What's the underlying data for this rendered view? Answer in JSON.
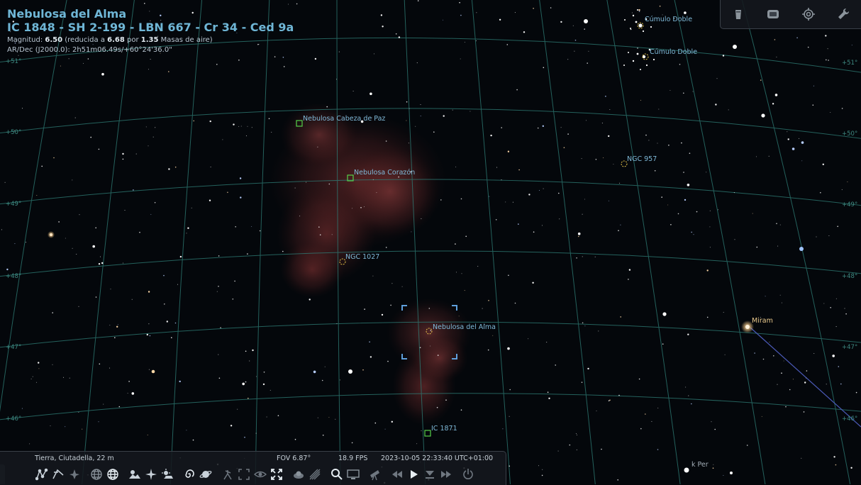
{
  "object": {
    "name": "Nebulosa del Alma",
    "designations": "IC 1848 - SH 2-199 - LBN 667 - Cr 34 - Ced 9a",
    "magnitude_label": "Magnitud:",
    "magnitude": "6.50",
    "magnitude_extra_1": "(reducida a",
    "magnitude_reduced": "6.68",
    "magnitude_extra_2": "por",
    "airmass": "1.35",
    "magnitude_extra_3": "Masas de aire)",
    "radec": "AR/Dec (J2000.0): 2h51m06.49s/+60°24'36.0\""
  },
  "labels": {
    "cabeza_paz": "Nebulosa Cabeza de Paz",
    "corazon": "Nebulosa Corazón",
    "ngc1027": "NGC 1027",
    "alma": "Nebulosa del Alma",
    "ic1871": "IC 1871",
    "ngc957": "NGC 957",
    "cumulo1": "Cúmulo Doble",
    "cumulo2": "Cúmulo Doble",
    "miram": "Miram",
    "kper": "k Per"
  },
  "grid_labels": {
    "l51": "+51°",
    "r51": "+51°",
    "l50": "+50°",
    "r50": "+50°",
    "l49": "+49°",
    "r49": "+49°",
    "l48": "+48°",
    "r48": "+48°",
    "l47": "+47°",
    "r47": "+47°",
    "l46": "+46°",
    "r46": "+46°"
  },
  "status": {
    "location": "Tierra, Ciutadella, 22 m",
    "fov": "FOV 6.87°",
    "fps": "18.9 FPS",
    "datetime": "2023-10-05 22:33:40 UTC+01:00"
  },
  "toolbar_top_right": [
    "window-icon",
    "tv-icon",
    "target-icon",
    "wrench-icon"
  ],
  "toolbar_bottom": [
    "constellation-lines-icon",
    "constellation-labels-icon",
    "constellation-art-icon",
    "equatorial-grid-icon",
    "azimuthal-grid-icon",
    "ground-icon",
    "cardinal-points-icon",
    "atmosphere-icon",
    "nebulae-icon",
    "planet-labels-icon",
    "equatorial-mount-icon",
    "center-object-icon",
    "night-mode-icon",
    "fullscreen-icon",
    "satellites-icon",
    "meteors-icon",
    "search-icon",
    "screen-icon",
    "telescope-icon",
    "rewind-icon",
    "play-icon",
    "now-icon",
    "fast-forward-icon",
    "quit-icon"
  ],
  "colors": {
    "title": "#6fb6d6",
    "grid": "#2f7f78",
    "label_dso": "#7fb9d8",
    "label_star": "#e9c98c",
    "marker": "#56d14a",
    "selection": "#5f9fdc"
  }
}
